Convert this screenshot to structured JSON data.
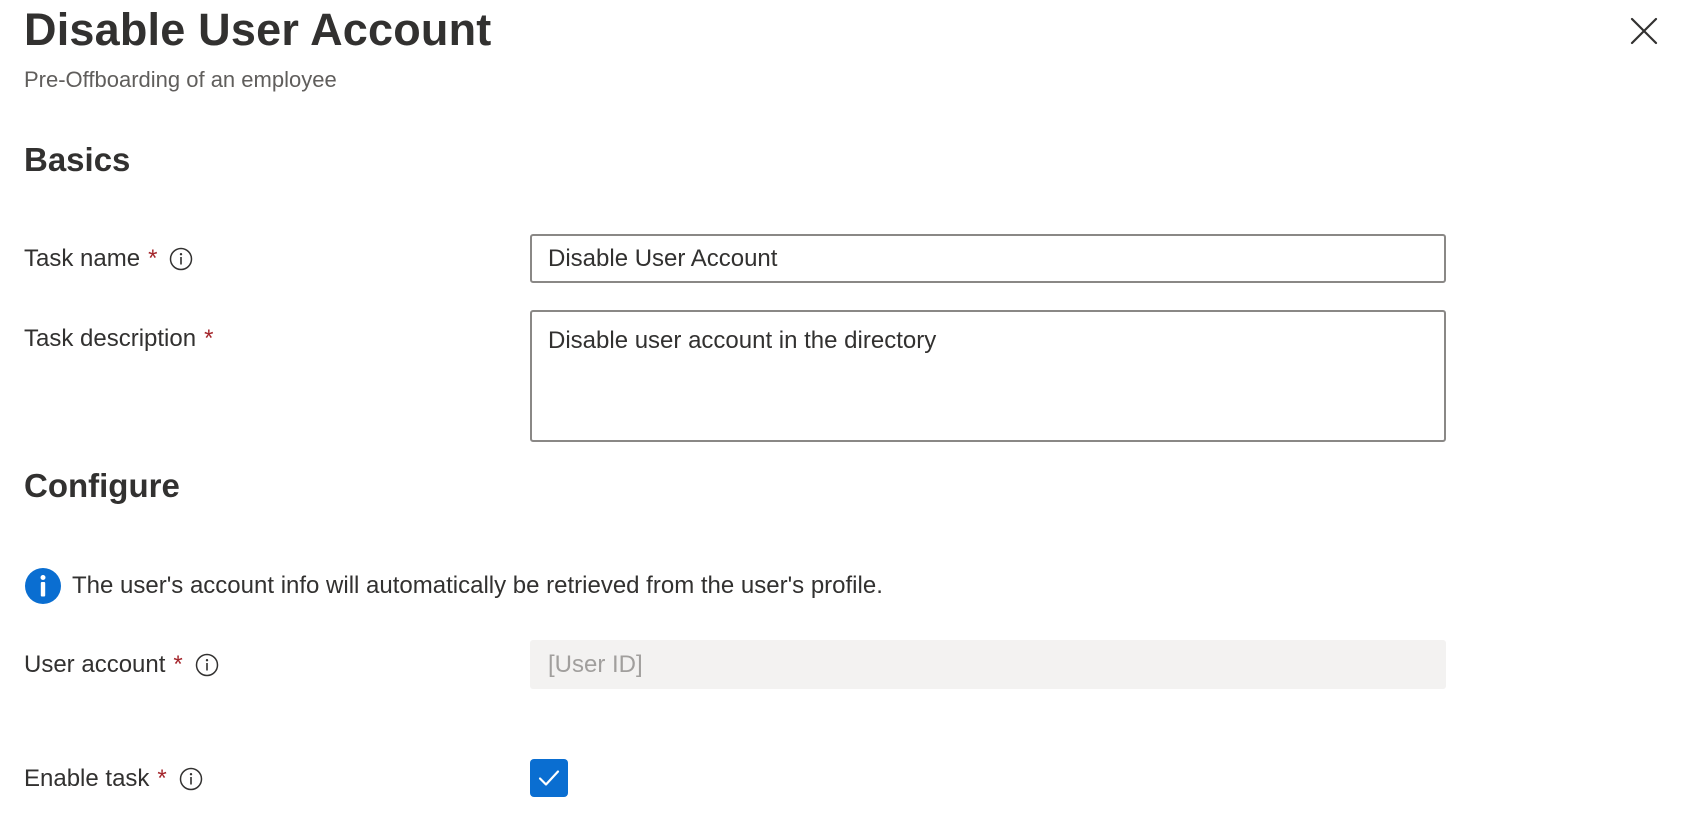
{
  "panel": {
    "title": "Disable User Account",
    "subtitle": "Pre-Offboarding of an employee",
    "close_icon": "close-icon"
  },
  "basics": {
    "heading": "Basics",
    "task_name": {
      "label": "Task name",
      "required_mark": "*",
      "value": "Disable User Account"
    },
    "task_description": {
      "label": "Task description",
      "required_mark": "*",
      "value": "Disable user account in the directory"
    }
  },
  "configure": {
    "heading": "Configure",
    "info_message": "The user's account info will automatically be retrieved from the user's profile.",
    "user_account": {
      "label": "User account",
      "required_mark": "*",
      "placeholder": "[User ID]"
    },
    "enable_task": {
      "label": "Enable task",
      "required_mark": "*",
      "checked": true
    }
  },
  "colors": {
    "accent": "#0a6ed1",
    "required": "#a4262c",
    "text": "#323130",
    "subtle_text": "#605e5c",
    "disabled_bg": "#f3f2f1",
    "disabled_text": "#a19f9d"
  }
}
